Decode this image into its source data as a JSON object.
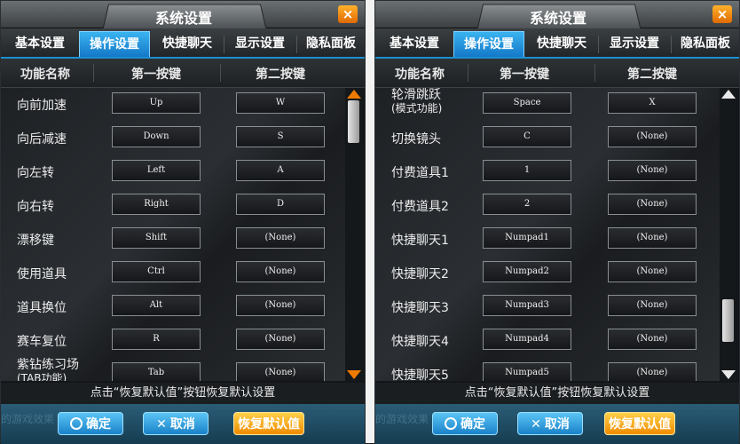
{
  "window": {
    "title": "系统设置",
    "close_glyph": "×"
  },
  "tabs": [
    "基本设置",
    "操作设置",
    "快捷聊天",
    "显示设置",
    "隐私面板"
  ],
  "columns": {
    "name": "功能名称",
    "key1": "第一按键",
    "key2": "第二按键"
  },
  "left": {
    "rows": [
      {
        "label": "向前加速",
        "k1": "Up",
        "k2": "W"
      },
      {
        "label": "向后减速",
        "k1": "Down",
        "k2": "S"
      },
      {
        "label": "向左转",
        "k1": "Left",
        "k2": "A"
      },
      {
        "label": "向右转",
        "k1": "Right",
        "k2": "D"
      },
      {
        "label": "漂移键",
        "k1": "Shift",
        "k2": "(None)"
      },
      {
        "label": "使用道具",
        "k1": "Ctrl",
        "k2": "(None)"
      },
      {
        "label": "道具换位",
        "k1": "Alt",
        "k2": "(None)"
      },
      {
        "label": "赛车复位",
        "k1": "R",
        "k2": "(None)"
      },
      {
        "label": "紫钻练习场",
        "sub": "(TAB功能)",
        "k1": "Tab",
        "k2": "(None)"
      }
    ]
  },
  "right": {
    "rows": [
      {
        "label": "轮滑跳跃",
        "sub": "(模式功能)",
        "k1": "Space",
        "k2": "X"
      },
      {
        "label": "切换镜头",
        "k1": "C",
        "k2": "(None)"
      },
      {
        "label": "付费道具1",
        "k1": "1",
        "k2": "(None)"
      },
      {
        "label": "付费道具2",
        "k1": "2",
        "k2": "(None)"
      },
      {
        "label": "快捷聊天1",
        "k1": "Numpad1",
        "k2": "(None)"
      },
      {
        "label": "快捷聊天2",
        "k1": "Numpad2",
        "k2": "(None)"
      },
      {
        "label": "快捷聊天3",
        "k1": "Numpad3",
        "k2": "(None)"
      },
      {
        "label": "快捷聊天4",
        "k1": "Numpad4",
        "k2": "(None)"
      },
      {
        "label": "快捷聊天5",
        "k1": "Numpad5",
        "k2": "(None)"
      }
    ]
  },
  "hint": "点击“恢复默认值”按钮恢复默认设置",
  "footer": {
    "ok": "确定",
    "cancel": "取消",
    "reset": "恢复默认值",
    "x_glyph": "✕",
    "bg_text": "的游戏效果"
  },
  "colors": {
    "accent_blue": "#1b8fd0",
    "accent_orange": "#f08b00"
  }
}
